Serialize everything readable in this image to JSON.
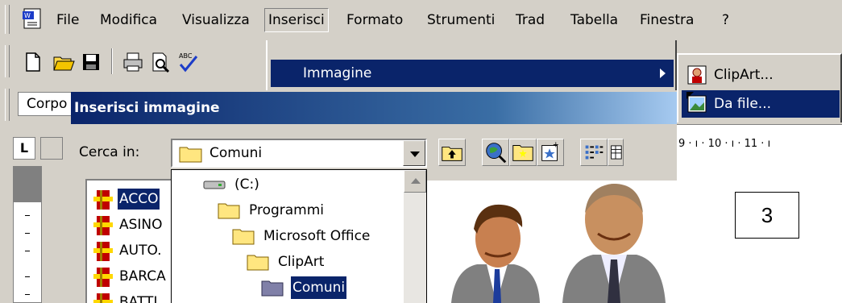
{
  "menubar": {
    "items": [
      {
        "label": "File"
      },
      {
        "label": "Modifica"
      },
      {
        "label": "Visualizza"
      },
      {
        "label": "Inserisci",
        "open": true
      },
      {
        "label": "Formato"
      },
      {
        "label": "Strumenti"
      },
      {
        "label": "Trad"
      },
      {
        "label": "Tabella"
      },
      {
        "label": "Finestra"
      },
      {
        "label": "?"
      }
    ]
  },
  "stylebar": {
    "style_value": "Corpo"
  },
  "insert_menu": {
    "item": {
      "label": "Immagine"
    }
  },
  "image_submenu": {
    "items": [
      {
        "label": "ClipArt...",
        "icon": "clipart-icon"
      },
      {
        "label": "Da file...",
        "icon": "image-file-icon",
        "selected": true
      }
    ]
  },
  "dialog": {
    "title": "Inserisci immagine",
    "look_in_label": "Cerca in:",
    "look_in_value": "Comuni",
    "files": [
      "ACCO",
      "ASINO",
      "AUTO.",
      "BARCA",
      "BATTI"
    ],
    "tree": [
      {
        "label": "(C:)",
        "level": 0,
        "icon": "drive-icon"
      },
      {
        "label": "Programmi",
        "level": 1,
        "icon": "folder-icon"
      },
      {
        "label": "Microsoft Office",
        "level": 2,
        "icon": "folder-icon"
      },
      {
        "label": "ClipArt",
        "level": 3,
        "icon": "folder-icon"
      },
      {
        "label": "Comuni",
        "level": 4,
        "icon": "folder-open-icon",
        "selected": true
      }
    ]
  },
  "ruler": {
    "text": "9 · ı · 10 · ı · 11 · ı"
  },
  "document": {
    "box_number": "3"
  },
  "colors": {
    "highlight": "#0a246a",
    "face": "#d4d0c8"
  }
}
